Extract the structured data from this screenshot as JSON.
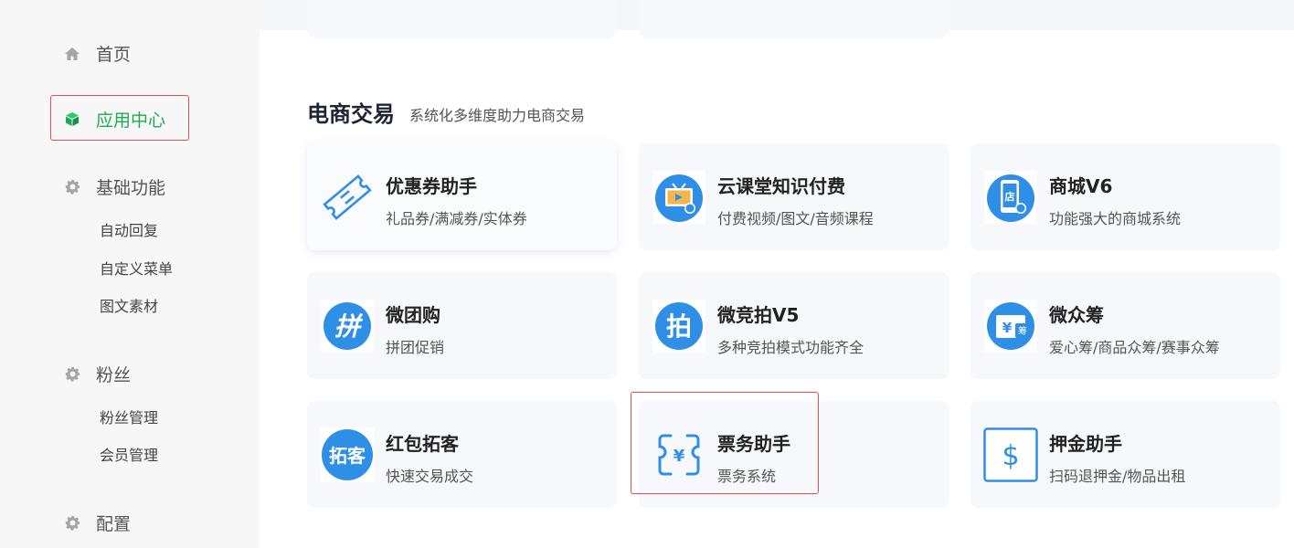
{
  "sidebar": {
    "home": "首页",
    "app_center": "应用中心",
    "basic": "基础功能",
    "basic_items": [
      "自动回复",
      "自定义菜单",
      "图文素材"
    ],
    "fans": "粉丝",
    "fans_items": [
      "粉丝管理",
      "会员管理"
    ],
    "config": "配置"
  },
  "section": {
    "title": "电商交易",
    "subtitle": "系统化多维度助力电商交易"
  },
  "cards": [
    {
      "title": "优惠券助手",
      "desc": "礼品券/满减券/实体券",
      "icon": "coupon-icon"
    },
    {
      "title": "云课堂知识付费",
      "desc": "付费视频/图文/音频课程",
      "icon": "video-course-icon"
    },
    {
      "title": "商城V6",
      "desc": "功能强大的商城系统",
      "icon": "shop-phone-icon"
    },
    {
      "title": "微团购",
      "desc": "拼团促销",
      "icon": "group-buy-icon"
    },
    {
      "title": "微竞拍V5",
      "desc": "多种竞拍模式功能齐全",
      "icon": "auction-icon"
    },
    {
      "title": "微众筹",
      "desc": "爱心筹/商品众筹/赛事众筹",
      "icon": "crowdfunding-icon"
    },
    {
      "title": "红包拓客",
      "desc": "快速交易成交",
      "icon": "red-packet-icon"
    },
    {
      "title": "票务助手",
      "desc": "票务系统",
      "icon": "ticket-icon"
    },
    {
      "title": "押金助手",
      "desc": "扫码退押金/物品出租",
      "icon": "deposit-icon"
    }
  ],
  "icon_glyphs": {
    "group_buy": "拼",
    "auction": "拍",
    "crowdfunding": "¥",
    "crowdfunding_badge": "筹",
    "red_packet": "拓客",
    "ticket": "¥",
    "deposit": "$",
    "shop": "店"
  },
  "colors": {
    "accent_green": "#1aad4e",
    "icon_blue": "#2f8fe6",
    "highlight_red": "#e84c4c"
  }
}
